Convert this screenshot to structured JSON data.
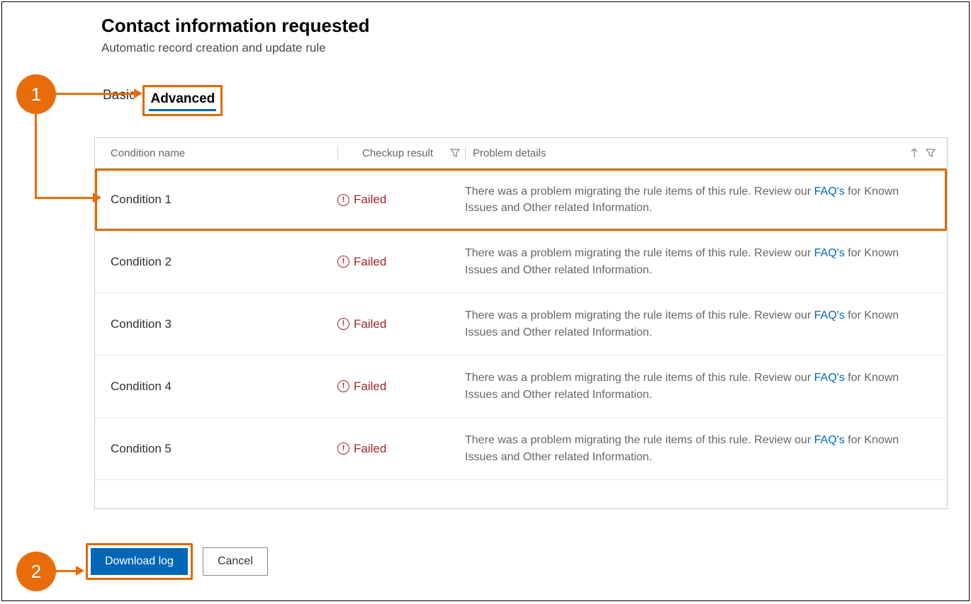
{
  "header": {
    "title": "Contact information requested",
    "subtitle": "Automatic record creation and update rule"
  },
  "tabs": {
    "basic": "Basic",
    "advanced": "Advanced",
    "active": "advanced"
  },
  "table": {
    "headers": {
      "condition": "Condition name",
      "result": "Checkup result",
      "details": "Problem details"
    },
    "rows": [
      {
        "name": "Condition 1",
        "result": "Failed",
        "details_pre": "There was a problem migrating the rule items of this rule. Review our ",
        "faq": "FAQ's",
        "details_post": " for Known Issues and Other related Information.",
        "highlight": true
      },
      {
        "name": "Condition 2",
        "result": "Failed",
        "details_pre": "There was a problem migrating the rule items of this rule. Review our ",
        "faq": "FAQ's",
        "details_post": " for Known Issues and Other related Information.",
        "highlight": false
      },
      {
        "name": "Condition 3",
        "result": "Failed",
        "details_pre": "There was a problem migrating the rule items of this rule. Review our ",
        "faq": "FAQ's",
        "details_post": " for Known Issues and Other related Information.",
        "highlight": false
      },
      {
        "name": "Condition 4",
        "result": "Failed",
        "details_pre": "There was a problem migrating the rule items of this rule. Review our ",
        "faq": "FAQ's",
        "details_post": " for Known Issues and Other related Information.",
        "highlight": false
      },
      {
        "name": "Condition 5",
        "result": "Failed",
        "details_pre": "There was a problem migrating the rule items of this rule. Review our ",
        "faq": "FAQ's",
        "details_post": " for Known Issues and Other related Information.",
        "highlight": false
      }
    ]
  },
  "buttons": {
    "download": "Download log",
    "cancel": "Cancel"
  },
  "callouts": {
    "one": "1",
    "two": "2"
  },
  "icons": {
    "error": "!",
    "filter": "filter-icon",
    "sort": "sort-up-icon"
  },
  "colors": {
    "accent": "#0067B8",
    "callout": "#E86C0A",
    "error": "#A4262C",
    "highlight_border": "#E06A00"
  }
}
